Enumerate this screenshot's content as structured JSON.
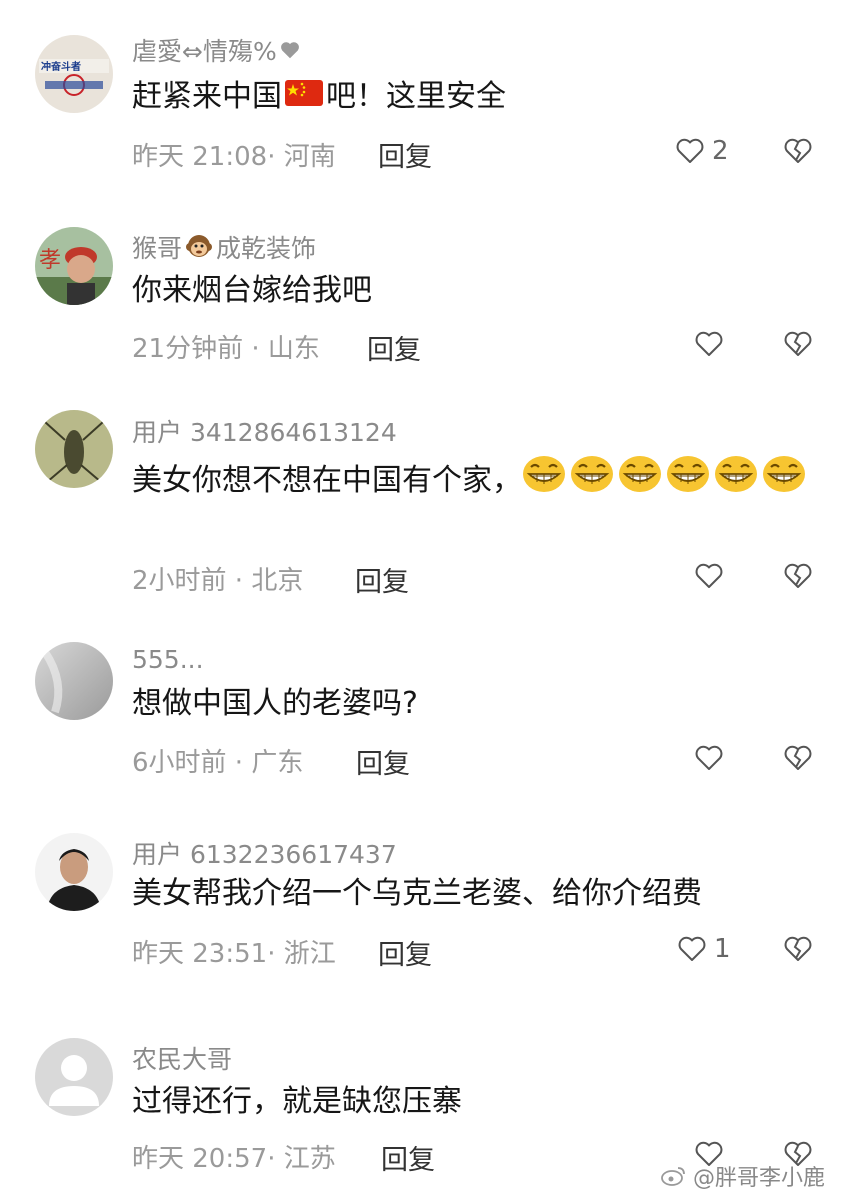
{
  "comments": [
    {
      "username": "虐愛⇔情殤%",
      "text_before_flag": "赶紧来中国",
      "text_after_flag": "吧！这里安全",
      "meta": "昨天 21:08· 河南",
      "reply": "回复",
      "likes": "2"
    },
    {
      "username_before": "猴哥",
      "username_after": "成乾装饰",
      "text": "你来烟台嫁给我吧",
      "meta": "21分钟前 · 山东",
      "reply": "回复",
      "likes": ""
    },
    {
      "username": "用户 3412864613124",
      "text": "美女你想不想在中国有个家，",
      "emoji_count": 6,
      "meta": "2小时前 · 北京",
      "reply": "回复",
      "likes": ""
    },
    {
      "username": "555...",
      "text": "想做中国人的老婆吗?",
      "meta": "6小时前 · 广东",
      "reply": "回复",
      "likes": ""
    },
    {
      "username": "用户 6132236617437",
      "text": "美女帮我介绍一个乌克兰老婆、给你介绍费",
      "meta": "昨天 23:51· 浙江",
      "reply": "回复",
      "likes": "1"
    },
    {
      "username": "农民大哥",
      "text": "过得还行，就是缺您压寨",
      "meta": "昨天 20:57· 江苏",
      "reply": "回复",
      "likes": ""
    }
  ],
  "avatar1_text": "冲奋斗者",
  "watermark": "@胖哥李小鹿",
  "colors": {
    "flag_red": "#de2910",
    "flag_star": "#ffde00",
    "emoji_yellow": "#f7c531"
  }
}
